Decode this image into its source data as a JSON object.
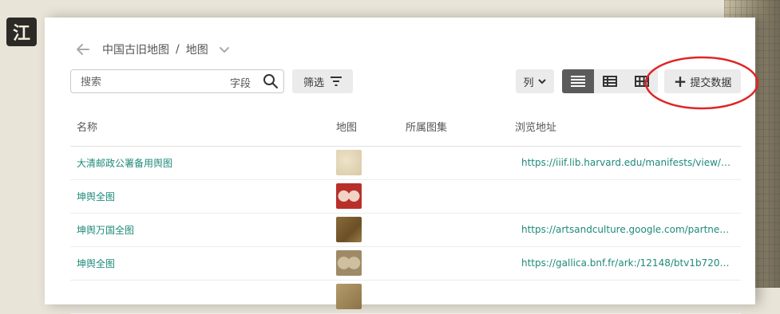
{
  "logo": {
    "char": "江"
  },
  "breadcrumb": {
    "parent": "中国古旧地图",
    "separator": "/",
    "current": "地图"
  },
  "toolbar": {
    "search_placeholder": "搜索",
    "search_field": "字段",
    "filter_label": "筛选",
    "columns_label": "列",
    "submit_label": "提交数据"
  },
  "table": {
    "headers": {
      "name": "名称",
      "map": "地图",
      "collection": "所属图集",
      "url": "浏览地址"
    },
    "rows": [
      {
        "name": "大清邮政公署备用舆图",
        "collection": "",
        "url": "https://iiif.lib.harvard.edu/manifests/view/id..."
      },
      {
        "name": "坤舆全图",
        "collection": "",
        "url": ""
      },
      {
        "name": "坤舆万国全图",
        "collection": "",
        "url": "https://artsandculture.google.com/partner/..."
      },
      {
        "name": "坤舆全图",
        "collection": "",
        "url": "https://gallica.bnf.fr/ark:/12148/btv1b72002..."
      },
      {
        "name": "",
        "collection": "",
        "url": ""
      }
    ]
  },
  "colors": {
    "accent": "#1e8a7a",
    "annotation": "#e02525",
    "active_view": "#5b5b5b"
  },
  "icons": [
    "back-arrow-icon",
    "chevron-down-icon",
    "search-icon",
    "filter-icon",
    "list-view-icon",
    "table-view-icon",
    "grid-view-icon",
    "plus-icon"
  ]
}
